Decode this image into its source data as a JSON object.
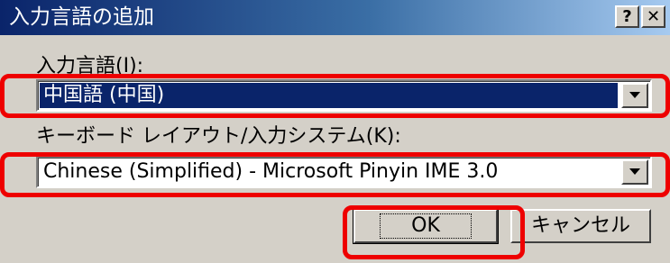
{
  "window": {
    "title": "入力言語の追加",
    "help_glyph": "?",
    "close_glyph": "✕"
  },
  "form": {
    "input_language_label": "入力言語(I):",
    "input_language_value": "中国語 (中国)",
    "keyboard_label": "キーボード レイアウト/入力システム(K):",
    "keyboard_value": "Chinese (Simplified) - Microsoft Pinyin IME 3.0"
  },
  "buttons": {
    "ok_label": "OK",
    "cancel_label": "キャンセル"
  },
  "colors": {
    "annotation": "#ee0000",
    "selection": "#0a246a",
    "dialog_face": "#d4d0c8"
  },
  "icons": {
    "help": "help-icon",
    "close": "close-icon",
    "dropdown": "dropdown-arrow-icon"
  }
}
